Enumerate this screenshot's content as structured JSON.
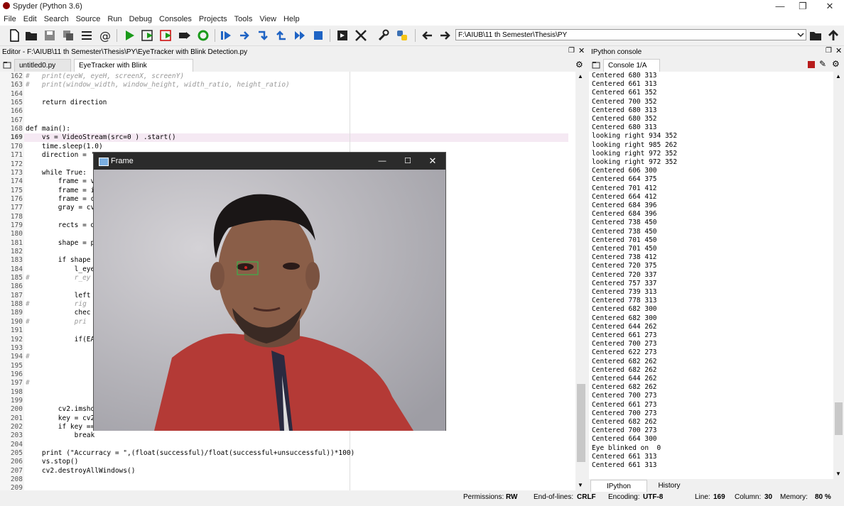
{
  "window": {
    "title": "Spyder (Python 3.6)"
  },
  "menu": [
    "File",
    "Edit",
    "Search",
    "Source",
    "Run",
    "Debug",
    "Consoles",
    "Projects",
    "Tools",
    "View",
    "Help"
  ],
  "toolbar": {
    "path": "F:\\AIUB\\11 th Semester\\Thesis\\PY"
  },
  "editor": {
    "title": "Editor - F:\\AIUB\\11 th Semester\\Thesis\\PY\\EyeTracker with Blink Detection.py",
    "tabs": [
      {
        "label": "untitled0.py"
      },
      {
        "label": "EyeTracker with Blink Detection.py"
      }
    ],
    "line_numbers": [
      "162",
      "163",
      "164",
      "165",
      "166",
      "167",
      "168",
      "169",
      "170",
      "171",
      "172",
      "173",
      "174",
      "175",
      "176",
      "177",
      "178",
      "179",
      "180",
      "181",
      "182",
      "183",
      "184",
      "185",
      "186",
      "187",
      "188",
      "189",
      "190",
      "191",
      "192",
      "193",
      "194",
      "195",
      "196",
      "197",
      "198",
      "199",
      "200",
      "201",
      "202",
      "203",
      "204",
      "205",
      "206",
      "207",
      "208",
      "209"
    ],
    "lines": [
      "#   print(eyeW, eyeH, screenX, screenY)",
      "#   print(window_width, window_height, width_ratio, height_ratio)",
      "",
      "    return direction",
      "",
      "",
      "def main():",
      "    vs = VideoStream(src=0 ) .start()",
      "    time.sleep(1.0)",
      "    direction = '",
      "",
      "    while True:",
      "        frame = v",
      "        frame = i",
      "        frame = c",
      "        gray = cv",
      "",
      "        rects = d",
      "",
      "        shape = p",
      "",
      "        if shape",
      "            l_eye",
      "#           r_ey",
      "",
      "            left",
      "#           rig",
      "            chec",
      "#           pri",
      "",
      "            if(EA",
      "",
      "#",
      "",
      "",
      "#",
      "",
      "",
      "        cv2.imsho",
      "        key = cv2",
      "        if key ==",
      "            break",
      "",
      "    print (\"Accurracy = \",(float(successful)/float(successful+unsuccessful))*100)",
      "    vs.stop()",
      "    cv2.destroyAllWindows()",
      "",
      ""
    ]
  },
  "frame_window": {
    "title": "Frame"
  },
  "console": {
    "title": "IPython console",
    "tab": "Console 1/A",
    "lines": [
      "Centered 680 313",
      "Centered 661 313",
      "Centered 661 352",
      "Centered 700 352",
      "Centered 680 313",
      "Centered 680 352",
      "Centered 680 313",
      "looking right 934 352",
      "looking right 985 262",
      "looking right 972 352",
      "looking right 972 352",
      "Centered 606 300",
      "Centered 664 375",
      "Centered 701 412",
      "Centered 664 412",
      "Centered 684 396",
      "Centered 684 396",
      "Centered 738 450",
      "Centered 738 450",
      "Centered 701 450",
      "Centered 701 450",
      "Centered 738 412",
      "Centered 720 375",
      "Centered 720 337",
      "Centered 757 337",
      "Centered 739 313",
      "Centered 778 313",
      "Centered 682 300",
      "Centered 682 300",
      "Centered 644 262",
      "Centered 661 273",
      "Centered 700 273",
      "Centered 622 273",
      "Centered 682 262",
      "Centered 682 262",
      "Centered 644 262",
      "Centered 682 262",
      "Centered 700 273",
      "Centered 661 273",
      "Centered 700 273",
      "Centered 682 262",
      "Centered 700 273",
      "Centered 664 300",
      "Eye blinked on  0",
      "Centered 661 313",
      "Centered 661 313"
    ],
    "bottom_tabs": [
      "IPython console",
      "History log"
    ]
  },
  "status": {
    "permissions_label": "Permissions:",
    "permissions": "RW",
    "eol_label": "End-of-lines:",
    "eol": "CRLF",
    "encoding_label": "Encoding:",
    "encoding": "UTF-8",
    "line_label": "Line:",
    "line": "169",
    "column_label": "Column:",
    "column": "30",
    "memory_label": "Memory:",
    "memory": "80 %"
  },
  "colors": {
    "run_green": "#1a9a1a",
    "accent_blue": "#1e63c4",
    "close_red": "#e0533a"
  }
}
